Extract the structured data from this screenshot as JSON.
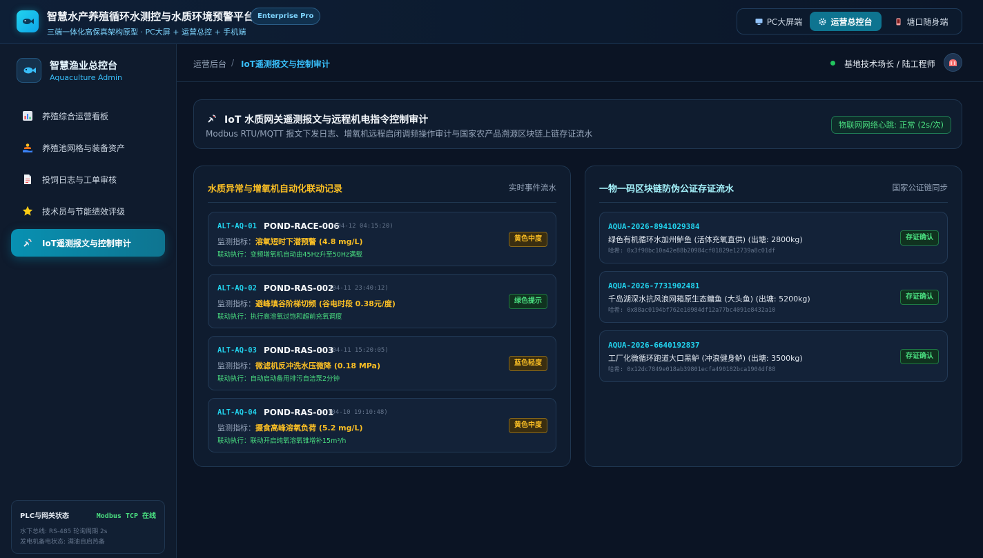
{
  "app": {
    "title": "智慧水产养殖循环水测控与水质环境预警平台",
    "subtitle": "三端一体化高保真架构原型 · PC大屏 + 运营总控 + 手机端",
    "edition_badge": "Enterprise Pro"
  },
  "mode_switch": [
    {
      "label": "PC大屏端",
      "icon": "monitor-icon",
      "active": false
    },
    {
      "label": "运营总控台",
      "icon": "gear-icon",
      "active": true
    },
    {
      "label": "塘口随身端",
      "icon": "phone-icon",
      "active": false
    }
  ],
  "sidebar": {
    "brand_title": "智慧渔业总控台",
    "brand_subtitle": "Aquaculture Admin",
    "items": [
      {
        "label": "养殖综合运营看板",
        "icon": "bar-chart-icon",
        "active": false
      },
      {
        "label": "养殖池网格与装备资产",
        "icon": "pool-icon",
        "active": false
      },
      {
        "label": "投饲日志与工单审核",
        "icon": "document-icon",
        "active": false
      },
      {
        "label": "技术员与节能绩效评级",
        "icon": "star-icon",
        "active": false
      },
      {
        "label": "IoT遥测报文与控制审计",
        "icon": "satellite-icon",
        "active": true
      }
    ],
    "plc": {
      "title": "PLC与网关状态",
      "status": "Modbus TCP 在线",
      "line1": "水下总线: RS-485 轮询周期 2s",
      "line2": "发电机备电状态: 满油自启热备"
    }
  },
  "header": {
    "breadcrumb_root": "运营后台",
    "breadcrumb_sep": "/",
    "breadcrumb_current": "IoT遥测报文与控制审计",
    "user": "基地技术场长 / 陆工程师"
  },
  "banner": {
    "title": "IoT 水质网关遥测报文与远程机电指令控制审计",
    "subtitle": "Modbus RTU/MQTT 报文下发日志、增氧机远程启闭调频操作审计与国家农产品溯源区块链上链存证流水",
    "heartbeat": "物联网网络心跳: 正常 (2s/次)"
  },
  "alerts_panel": {
    "title": "水质异常与增氧机自动化联动记录",
    "tag": "实时事件流水",
    "metric_prefix": "监测指标：",
    "action_prefix": "联动执行：",
    "items": [
      {
        "id": "ALT-AQ-01",
        "pond": "POND-RACE-006",
        "time": "(04-12 04:15:20)",
        "metric": "溶氧短时下潜预警 (4.8 mg/L)",
        "action": "变频增氧机自动由45Hz升至50Hz满载",
        "severity": "黄色中度",
        "severity_color": "#fbbf24"
      },
      {
        "id": "ALT-AQ-02",
        "pond": "POND-RAS-002",
        "time": "(04-11 23:40:12)",
        "metric": "避峰填谷阶梯切频 (谷电时段 0.38元/度)",
        "action": "执行高溶氧过饱和超前充氧调度",
        "severity": "绿色提示",
        "severity_color": "#4ade80"
      },
      {
        "id": "ALT-AQ-03",
        "pond": "POND-RAS-003",
        "time": "(04-11 15:20:05)",
        "metric": "微滤机反冲洗水压微降 (0.18 MPa)",
        "action": "自动启动备用排污自洁泵2分钟",
        "severity": "蓝色轻度",
        "severity_color": "#fbbf24"
      },
      {
        "id": "ALT-AQ-04",
        "pond": "POND-RAS-001",
        "time": "(04-10 19:10:48)",
        "metric": "摄食高峰溶氧负荷 (5.2 mg/L)",
        "action": "联动开启纯氧溶氧锥增补15m³/h",
        "severity": "黄色中度",
        "severity_color": "#fbbf24"
      }
    ]
  },
  "chain_panel": {
    "title": "一物一码区块链防伪公证存证流水",
    "tag": "国家公证链同步",
    "hash_prefix": "哈希: ",
    "items": [
      {
        "id": "AQUA-2026-8941029384",
        "desc": "绿色有机循环水加州鲈鱼 (活体充氧直供) (出塘: 2800kg)",
        "hash": "0x3f98bc10a42e88b20984cf01829e12739a8c01df",
        "status": "存证确认"
      },
      {
        "id": "AQUA-2026-7731902481",
        "desc": "千岛湖深水抗风浪网箱原生态鳙鱼 (大头鱼) (出塘: 5200kg)",
        "hash": "0x88ac0194bf762e10984df12a77bc4091e8432a10",
        "status": "存证确认"
      },
      {
        "id": "AQUA-2026-6640192837",
        "desc": "工厂化微循环跑道大口黑鲈 (冲浪健身鲈) (出塘: 3500kg)",
        "hash": "0x12dc7849e018ab39801ecfa490182bca1904df88",
        "status": "存证确认"
      }
    ]
  },
  "colors": {
    "accent": "#0891b2",
    "panel_title_left": "#fbbf24",
    "panel_title_right": "#a5f3fc",
    "ok": "#4ade80"
  }
}
